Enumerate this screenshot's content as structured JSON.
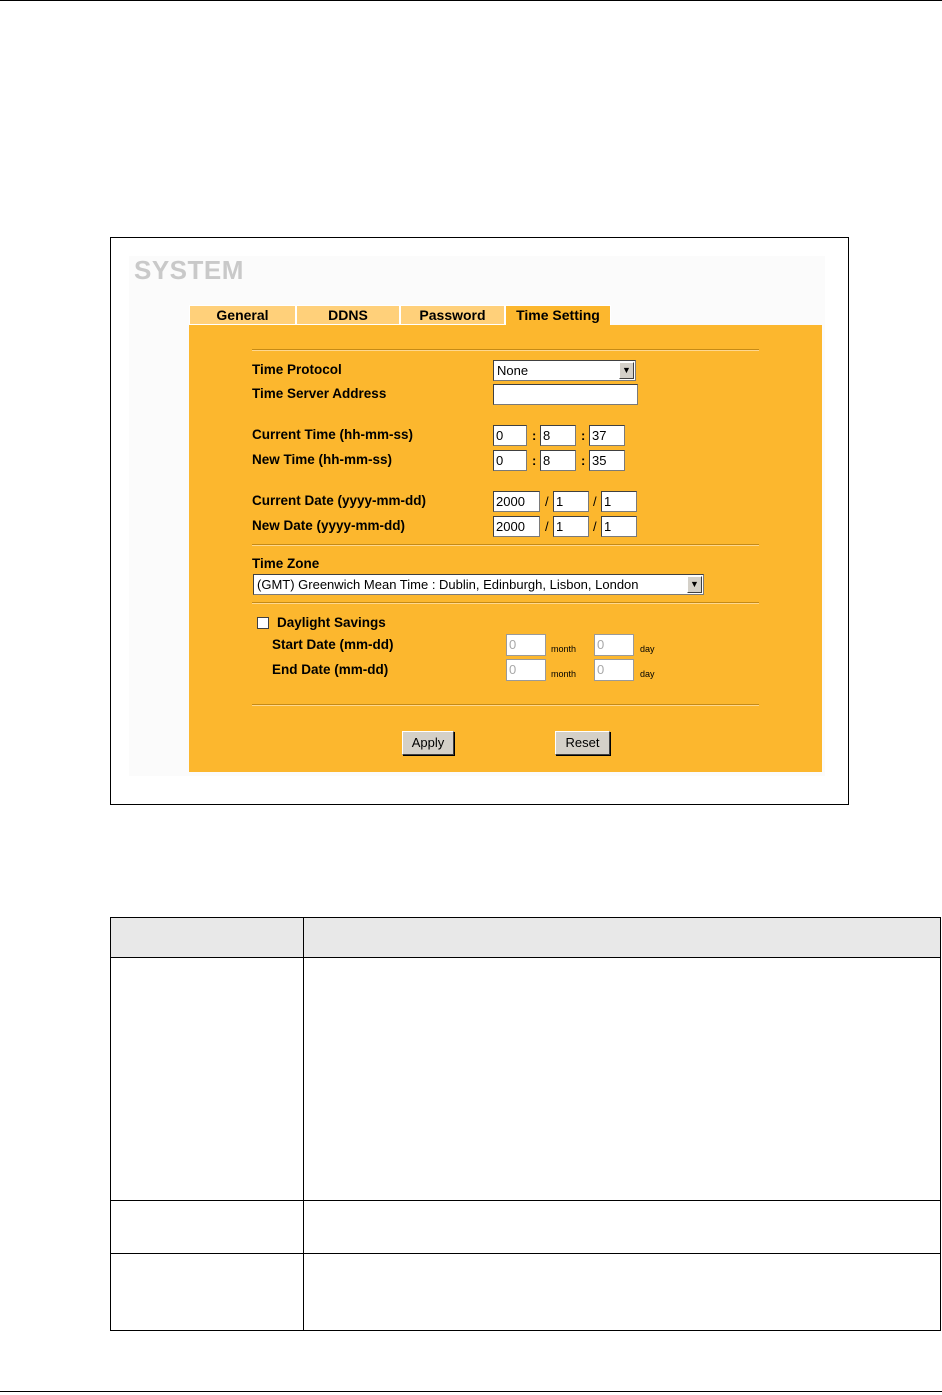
{
  "screen": {
    "title": "SYSTEM",
    "tabs": [
      {
        "label": "General",
        "active": false
      },
      {
        "label": "DDNS",
        "active": false
      },
      {
        "label": "Password",
        "active": false
      },
      {
        "label": "Time Setting",
        "active": true
      }
    ],
    "form": {
      "time_protocol": {
        "label": "Time Protocol",
        "value": "None"
      },
      "time_server": {
        "label": "Time Server Address",
        "value": ""
      },
      "current_time": {
        "label": "Current Time (hh-mm-ss)",
        "hh": "0",
        "mm": "8",
        "ss": "37",
        "sep": ":"
      },
      "new_time": {
        "label": "New Time (hh-mm-ss)",
        "hh": "0",
        "mm": "8",
        "ss": "35",
        "sep": ":"
      },
      "current_date": {
        "label": "Current Date (yyyy-mm-dd)",
        "yyyy": "2000",
        "mm": "1",
        "dd": "1",
        "sep": "/"
      },
      "new_date": {
        "label": "New Date (yyyy-mm-dd)",
        "yyyy": "2000",
        "mm": "1",
        "dd": "1",
        "sep": "/"
      },
      "time_zone": {
        "label": "Time Zone",
        "value": "(GMT) Greenwich Mean Time : Dublin, Edinburgh, Lisbon, London"
      },
      "daylight_savings": {
        "label": "Daylight Savings",
        "checked": false,
        "start": {
          "label": "Start Date (mm-dd)",
          "month": "0",
          "day": "0"
        },
        "end": {
          "label": "End Date (mm-dd)",
          "month": "0",
          "day": "0"
        },
        "month_unit": "month",
        "day_unit": "day"
      }
    },
    "buttons": {
      "apply": "Apply",
      "reset": "Reset"
    }
  }
}
